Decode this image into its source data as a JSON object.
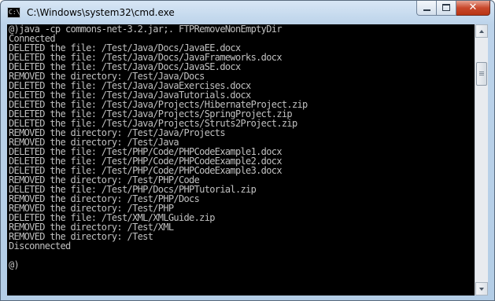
{
  "window": {
    "title": "C:\\Windows\\system32\\cmd.exe",
    "icon_text": "C:\\"
  },
  "console": {
    "lines": [
      "@)java -cp commons-net-3.2.jar;. FTPRemoveNonEmptyDir",
      "Connected",
      "DELETED the file: /Test/Java/Docs/JavaEE.docx",
      "DELETED the file: /Test/Java/Docs/JavaFrameworks.docx",
      "DELETED the file: /Test/Java/Docs/JavaSE.docx",
      "REMOVED the directory: /Test/Java/Docs",
      "DELETED the file: /Test/Java/JavaExercises.docx",
      "DELETED the file: /Test/Java/JavaTutorials.docx",
      "DELETED the file: /Test/Java/Projects/HibernateProject.zip",
      "DELETED the file: /Test/Java/Projects/SpringProject.zip",
      "DELETED the file: /Test/Java/Projects/Struts2Project.zip",
      "REMOVED the directory: /Test/Java/Projects",
      "REMOVED the directory: /Test/Java",
      "DELETED the file: /Test/PHP/Code/PHPCodeExample1.docx",
      "DELETED the file: /Test/PHP/Code/PHPCodeExample2.docx",
      "DELETED the file: /Test/PHP/Code/PHPCodeExample3.docx",
      "REMOVED the directory: /Test/PHP/Code",
      "DELETED the file: /Test/PHP/Docs/PHPTutorial.zip",
      "REMOVED the directory: /Test/PHP/Docs",
      "REMOVED the directory: /Test/PHP",
      "DELETED the file: /Test/XML/XMLGuide.zip",
      "REMOVED the directory: /Test/XML",
      "REMOVED the directory: /Test",
      "Disconnected",
      "",
      "@)"
    ],
    "background": "#000000",
    "text_color": "#c0c0c0"
  },
  "controls": {
    "close_glyph": "✕"
  },
  "icons": {
    "app": "cmd-icon",
    "minimize": "minimize-icon",
    "maximize": "maximize-icon",
    "close": "close-icon",
    "scroll_up": "scroll-up-arrow-icon",
    "scroll_down": "scroll-down-arrow-icon"
  }
}
